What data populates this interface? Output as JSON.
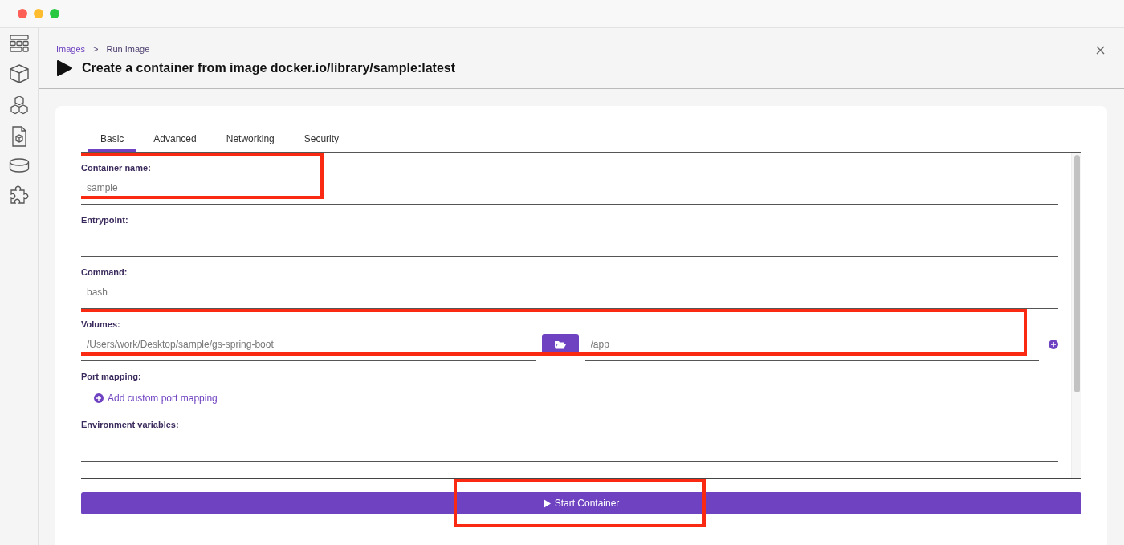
{
  "breadcrumb": [
    {
      "label": "Images",
      "kind": "link"
    },
    {
      "label": "Run Image",
      "kind": "current"
    }
  ],
  "breadcrumb_separator": ">",
  "title": "Create a container from image docker.io/library/sample:latest",
  "tabs": [
    {
      "label": "Basic",
      "selected": true
    },
    {
      "label": "Advanced",
      "selected": false
    },
    {
      "label": "Networking",
      "selected": false
    },
    {
      "label": "Security",
      "selected": false
    }
  ],
  "fields": [
    {
      "kind": "text",
      "label": "Container name:",
      "placeholder": "sample",
      "highlighted": true
    },
    {
      "kind": "text",
      "label": "Entrypoint:",
      "highlighted": false
    },
    {
      "kind": "text",
      "label": "Command:",
      "placeholder": "bash",
      "highlighted": false
    },
    {
      "kind": "volume",
      "label": "Volumes:",
      "host_placeholder": "/Users/work/Desktop/sample/gs-spring-boot",
      "container_placeholder": "/app",
      "highlighted": true
    },
    {
      "kind": "port",
      "label": "Port mapping:",
      "link": "Add custom port mapping",
      "highlighted": false
    },
    {
      "kind": "text",
      "label": "Environment variables:",
      "highlighted": false
    }
  ],
  "start_button": {
    "label": "Start Container",
    "highlighted": true
  }
}
